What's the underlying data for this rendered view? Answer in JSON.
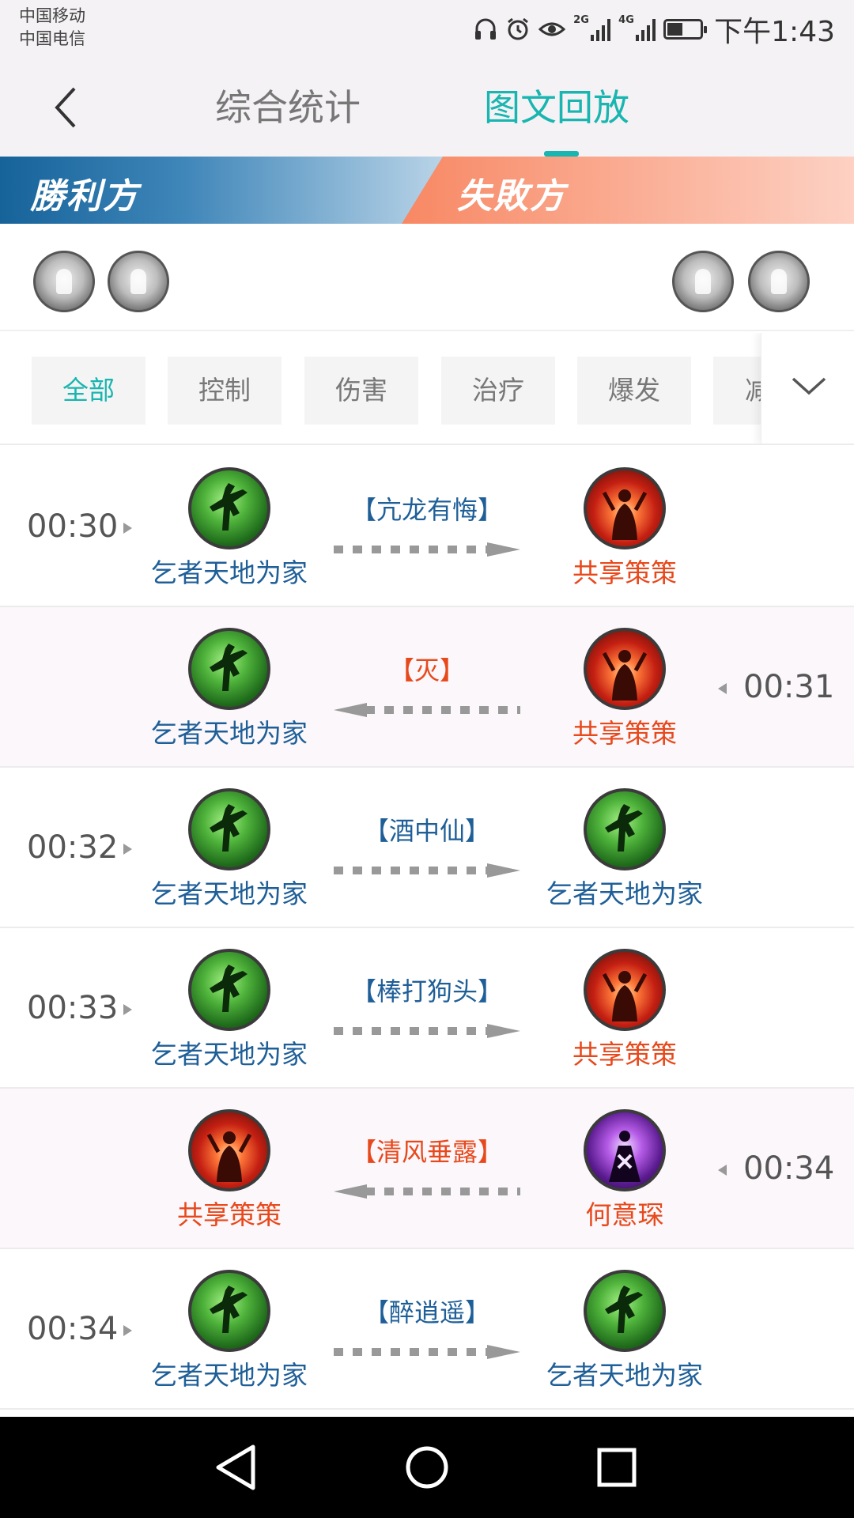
{
  "status_bar": {
    "carrier_1": "中国移动",
    "carrier_2": "中国电信",
    "network_1": "2G",
    "network_2": "4G",
    "time": "下午1:43",
    "icons": [
      "headphones-icon",
      "alarm-icon",
      "eye-icon",
      "signal-icon",
      "battery-icon"
    ]
  },
  "header": {
    "back_icon": "chevron-left-icon",
    "tabs": [
      {
        "label": "综合统计",
        "active": false
      },
      {
        "label": "图文回放",
        "active": true
      }
    ]
  },
  "teams": {
    "winner_label": "勝利方",
    "loser_label": "失敗方",
    "winner_color": "#16639a",
    "loser_color": "#f4521f"
  },
  "filters": {
    "chips": [
      {
        "label": "全部",
        "active": true
      },
      {
        "label": "控制",
        "active": false
      },
      {
        "label": "伤害",
        "active": false
      },
      {
        "label": "治疗",
        "active": false
      },
      {
        "label": "爆发",
        "active": false
      },
      {
        "label": "减",
        "active": false
      }
    ],
    "expand_icon": "chevron-down-icon"
  },
  "events": [
    {
      "time": "00:30",
      "side": "left",
      "skill": "【亢龙有悔】",
      "source": "乞者天地为家",
      "target": "共享策策"
    },
    {
      "time": "00:31",
      "side": "right",
      "skill": "【灭】",
      "source": "共享策策",
      "target": "乞者天地为家"
    },
    {
      "time": "00:32",
      "side": "left",
      "skill": "【酒中仙】",
      "source": "乞者天地为家",
      "target": "乞者天地为家"
    },
    {
      "time": "00:33",
      "side": "left",
      "skill": "【棒打狗头】",
      "source": "乞者天地为家",
      "target": "共享策策"
    },
    {
      "time": "00:34",
      "side": "right",
      "skill": "【清风垂露】",
      "source": "何意琛",
      "target": "共享策策"
    },
    {
      "time": "00:34",
      "side": "left",
      "skill": "【醉逍遥】",
      "source": "乞者天地为家",
      "target": "乞者天地为家"
    }
  ],
  "colors": {
    "accent": "#19b5b0",
    "winner_name": "#1f5f98",
    "loser_name": "#e8491c"
  }
}
